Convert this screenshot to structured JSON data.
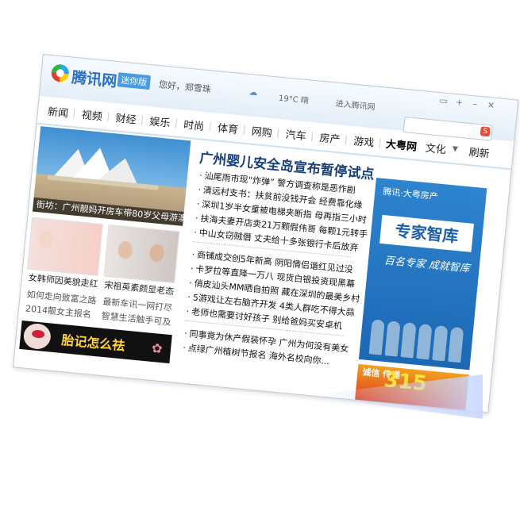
{
  "titlebar": {
    "brand": "腾讯网",
    "edition": "迷你版",
    "greeting": "您好，郑雪珠",
    "temp": "19°C 晴",
    "enter": "进入腾讯网"
  },
  "nav": {
    "items": [
      "新闻",
      "视频",
      "财经",
      "娱乐",
      "时尚",
      "体育",
      "网购",
      "汽车",
      "房产",
      "游戏",
      "大粤网",
      "文化",
      "刷新"
    ]
  },
  "feature": {
    "caption": "街坊：广州靓妈开房车带80岁父母游澳洲"
  },
  "thumbs": [
    {
      "caption": "女韩师因美貌走红"
    },
    {
      "caption": "宋祖英素颜显老态"
    }
  ],
  "left_links": [
    "如何走向致富之路",
    "最新车讯一网打尽",
    "2014靓女主报名",
    "智慧生活触手可及"
  ],
  "ad_left": {
    "text": "胎记怎么祛"
  },
  "headline": "广州婴儿安全岛宣布暂停试点",
  "news": {
    "group1": [
      "汕尾雨市现“炸弹” 警方调查称是恶作剧",
      "清远村支书：扶贫前没钱开会 经费靠化缘",
      "深圳1岁半女童被电梯夹断指 母再指三小时",
      "扶海夫妻开店卖21万颗假伟哥 每颗1元转手",
      "中山女窃贼僭 丈夫给十多张银行卡后放弃"
    ],
    "group2": [
      "商铺成交创5年新高 阴阳情侣谐红见过没",
      "卡罗拉等直降一万八 现货白银投资现黑幕",
      "俏皮汕头MM晒自拍照 藏在深圳的最美乡村",
      "5游戏让左右脑齐开发 4类人群吃不得大蒜",
      "老师也需要讨好孩子 别给爸妈买安卓机"
    ],
    "group3": [
      "同事竟为休产假装怀孕 广州为何没有美女",
      "点绿广州植树节报名 海外名校向你..."
    ]
  },
  "ad_right": {
    "logo": "腾讯·大粤房产",
    "head": "专家智库",
    "sub": "百名专家 成就智库"
  },
  "ad_315": {
    "left": "诚信 传递",
    "num": "315"
  },
  "icons": [
    "qq-logo-icon",
    "weather-icon",
    "search-icon",
    "minimize-icon",
    "close-icon"
  ]
}
